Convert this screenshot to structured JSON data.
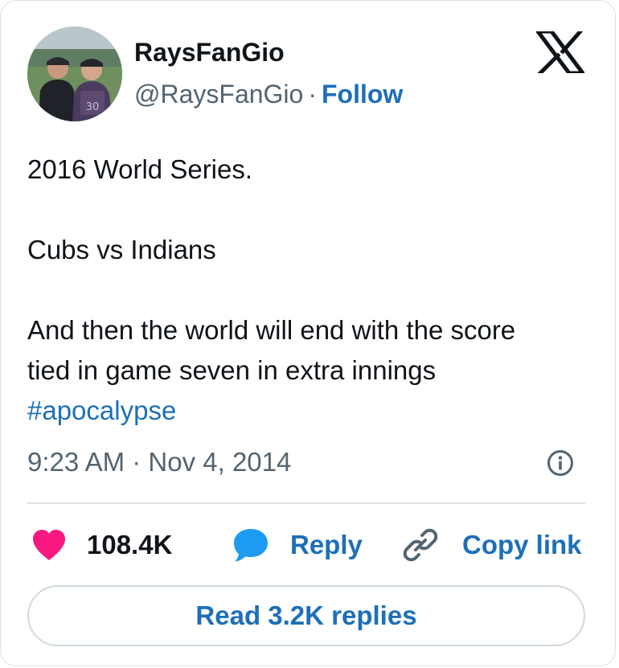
{
  "author": {
    "name": "RaysFanGio",
    "handle": "@RaysFanGio",
    "separator": "·",
    "follow_label": "Follow",
    "avatar_icon": "profile-photo-two-men"
  },
  "brand_icon": "x-logo",
  "tweet": {
    "lines": [
      "2016 World Series.",
      "Cubs vs Indians",
      "And then the world will end with  the score",
      "tied in game seven in extra innings"
    ],
    "hashtag": "#apocalypse"
  },
  "timestamp": "9:23 AM · Nov 4, 2014",
  "info_icon": "info-icon",
  "actions": {
    "likes": "108.4K",
    "reply_label": "Reply",
    "copy_link_label": "Copy link"
  },
  "read_replies_label": "Read 3.2K replies",
  "colors": {
    "link_blue": "#1d6fb8",
    "like_pink": "#f91880",
    "reply_blue": "#1d9bf0",
    "text_primary": "#0f1419",
    "text_secondary": "#536471",
    "border": "#cfd9de"
  }
}
